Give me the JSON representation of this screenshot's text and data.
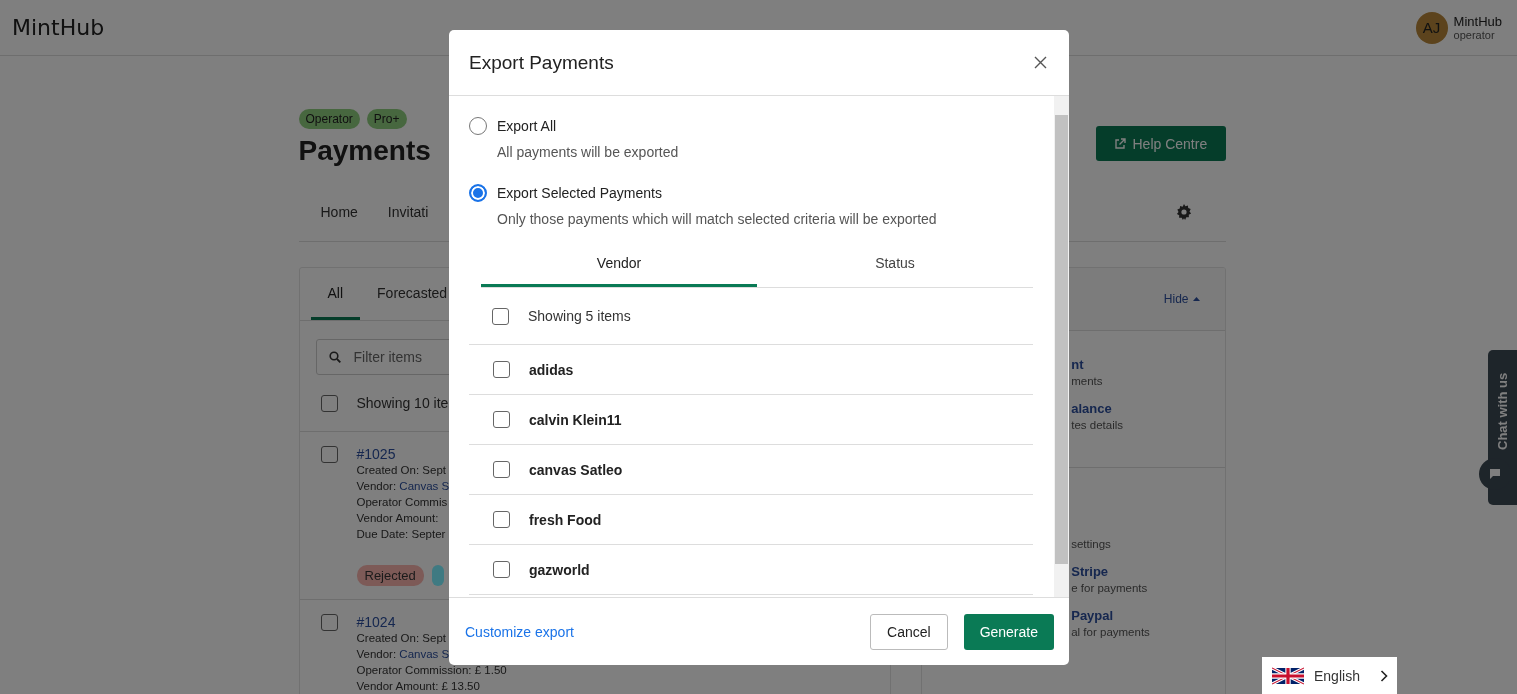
{
  "header": {
    "logo": "MintHub",
    "user": {
      "initials": "AJ",
      "name": "MintHub",
      "role": "operator"
    }
  },
  "page": {
    "badges": [
      "Operator",
      "Pro+"
    ],
    "title": "Payments",
    "help_button": "Help Centre",
    "nav": [
      "Home",
      "Invitati"
    ]
  },
  "list_card": {
    "tabs": [
      {
        "label": "All",
        "selected": true
      },
      {
        "label": "Forecasted",
        "selected": false
      }
    ],
    "filter": {
      "placeholder": "Filter items"
    },
    "select_all": {
      "label": "Showing 10 ite",
      "checked": false
    },
    "payments": [
      {
        "id": "#1025",
        "checked": false,
        "lines": [
          {
            "text": "Created On: Sept"
          },
          {
            "text": "Vendor:",
            "link": "Canvas S"
          },
          {
            "text": "Operator Commis"
          },
          {
            "text": "Vendor Amount:"
          },
          {
            "text": "Due Date: Septer"
          }
        ],
        "badges": [
          {
            "label": "Rejected",
            "color": "#7d5a57"
          },
          {
            "color": "#3f7a82"
          }
        ]
      },
      {
        "id": "#1024",
        "checked": false,
        "lines": [
          {
            "text": "Created On: Sept"
          },
          {
            "text": "Vendor:",
            "link": "Canvas S"
          },
          {
            "text": "Operator Commission: £ 1.50"
          },
          {
            "text": "Vendor Amount: £ 13.50"
          }
        ]
      }
    ]
  },
  "side_card": {
    "hide_link": "Hide",
    "sections": [
      [
        {
          "title": "nt",
          "subtitle": "ments"
        },
        {
          "title": "alance",
          "subtitle": "tes details"
        }
      ],
      [
        {
          "subtitle": "settings"
        },
        {
          "title": "Stripe",
          "subtitle": "e for payments"
        },
        {
          "title": "Paypal",
          "subtitle": "al for payments"
        }
      ]
    ]
  },
  "modal": {
    "title": "Export Payments",
    "options": [
      {
        "label": "Export All",
        "description": "All payments will be exported",
        "selected": false
      },
      {
        "label": "Export Selected Payments",
        "description": "Only those payments which will match selected criteria will be exported",
        "selected": true
      }
    ],
    "tabs": [
      {
        "label": "Vendor",
        "selected": true
      },
      {
        "label": "Status",
        "selected": false
      }
    ],
    "select_all": {
      "label": "Showing 5 items",
      "checked": false
    },
    "vendors": [
      {
        "name": "adidas",
        "checked": false
      },
      {
        "name": "calvin Klein11",
        "checked": false
      },
      {
        "name": "canvas Satleo",
        "checked": false
      },
      {
        "name": "fresh Food",
        "checked": false
      },
      {
        "name": "gazworld",
        "checked": false
      }
    ],
    "customize_link": "Customize export",
    "cancel": "Cancel",
    "generate": "Generate"
  },
  "chat": {
    "label": "Chat with us"
  },
  "language": {
    "label": "English"
  }
}
